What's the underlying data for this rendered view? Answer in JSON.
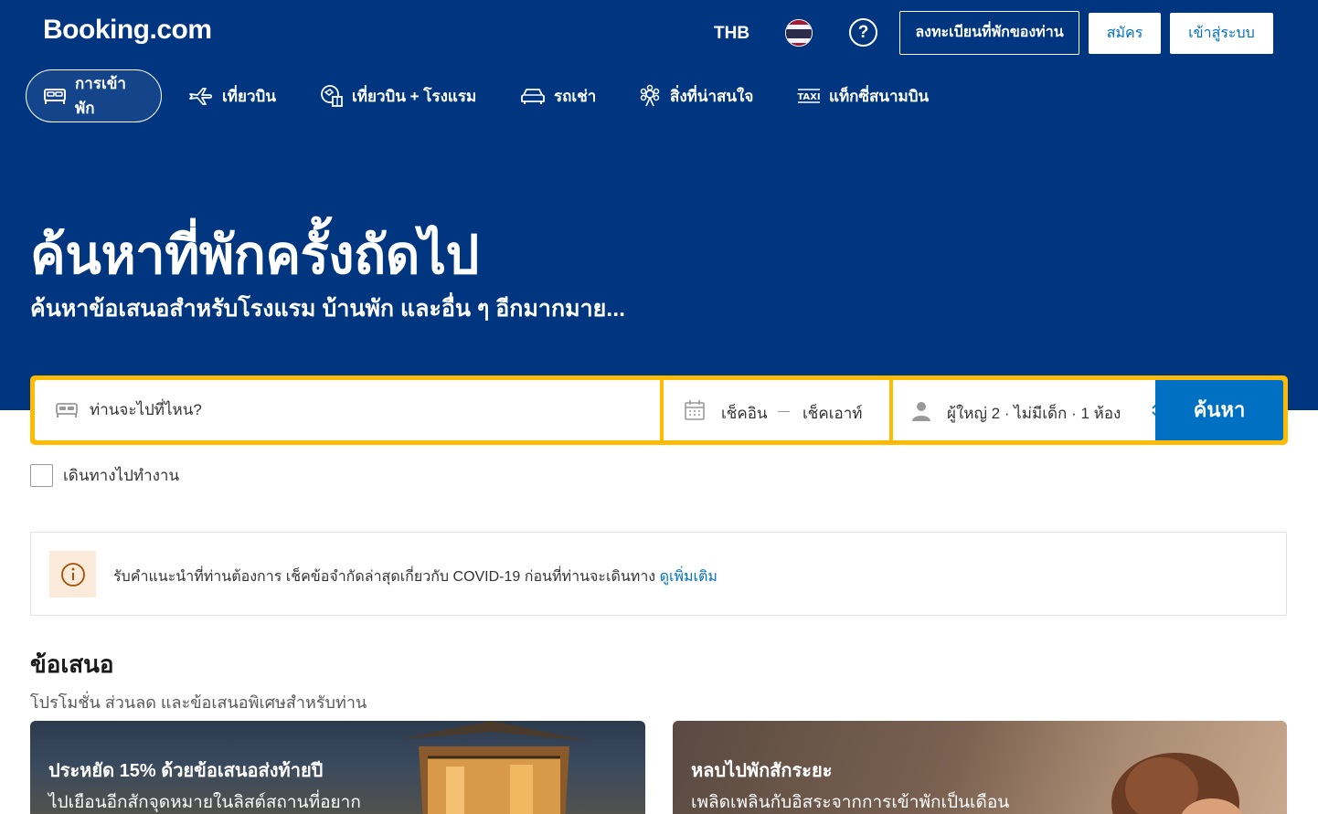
{
  "header": {
    "logo": "Booking.com",
    "currency": "THB",
    "flag_icon": "thailand-flag-icon",
    "help_symbol": "?",
    "list_property": "ลงทะเบียนที่พักของท่าน",
    "register": "สมัคร",
    "sign_in": "เข้าสู่ระบบ"
  },
  "nav": {
    "items": [
      {
        "label": "การเข้าพัก",
        "icon": "bed-icon",
        "active": true
      },
      {
        "label": "เที่ยวบิน",
        "icon": "plane-icon",
        "active": false
      },
      {
        "label": "เที่ยวบิน + โรงแรม",
        "icon": "flight-hotel-icon",
        "active": false
      },
      {
        "label": "รถเช่า",
        "icon": "car-icon",
        "active": false
      },
      {
        "label": "สิ่งที่น่าสนใจ",
        "icon": "attractions-icon",
        "active": false
      },
      {
        "label": "แท็กซี่สนามบิน",
        "icon": "taxi-icon",
        "active": false
      }
    ]
  },
  "hero": {
    "title": "ค้นหาที่พักครั้งถัดไป",
    "subtitle": "ค้นหาข้อเสนอสำหรับโรงแรม บ้านพัก และอื่น ๆ อีกมากมาย..."
  },
  "search": {
    "destination_placeholder": "ท่านจะไปที่ไหน?",
    "checkin": "เช็คอิน",
    "checkout": "เช็คเอาท์",
    "guests": "ผู้ใหญ่ 2 · ไม่มีเด็ก · 1 ห้อง",
    "button": "ค้นหา",
    "business_travel": "เดินทางไปทำงาน"
  },
  "notice": {
    "text": "รับคำแนะนำที่ท่านต้องการ เช็คข้อจำกัดล่าสุดเกี่ยวกับ COVID-19 ก่อนที่ท่านจะเดินทาง",
    "link": "ดูเพิ่มเติม"
  },
  "deals": {
    "title": "ข้อเสนอ",
    "subtitle": "โปรโมชั่น ส่วนลด และข้อเสนอพิเศษสำหรับท่าน",
    "cards": [
      {
        "title": "ประหยัด 15% ด้วยข้อเสนอส่งท้ายปี",
        "text": "ไปเยือนอีกสักจุดหมายในลิสต์สถานที่อยาก"
      },
      {
        "title": "หลบไปพักสักระยะ",
        "text": "เพลิดเพลินกับอิสระจากการเข้าพักเป็นเดือน"
      }
    ]
  },
  "colors": {
    "brand_blue": "#003580",
    "action_blue": "#0071c2",
    "search_border": "#febb02"
  }
}
